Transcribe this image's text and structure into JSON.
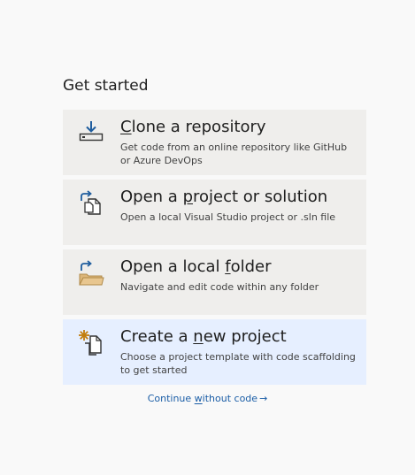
{
  "heading": "Get started",
  "cards": [
    {
      "id": "clone",
      "title_before": "",
      "title_hotkey": "C",
      "title_after": "lone a repository",
      "description": "Get code from an online repository like GitHub or Azure DevOps",
      "icon": "download-icon"
    },
    {
      "id": "open-project",
      "title_before": "Open a ",
      "title_hotkey": "p",
      "title_after": "roject or solution",
      "description": "Open a local Visual Studio project or .sln file",
      "icon": "open-project-icon"
    },
    {
      "id": "open-folder",
      "title_before": "Open a local ",
      "title_hotkey": "f",
      "title_after": "older",
      "description": "Navigate and edit code within any folder",
      "icon": "open-folder-icon"
    },
    {
      "id": "new-project",
      "title_before": "Create a ",
      "title_hotkey": "n",
      "title_after": "ew project",
      "description": "Choose a project template with code scaffolding to get started",
      "icon": "new-project-icon",
      "selected": true
    }
  ],
  "continue": {
    "before": "Continue ",
    "hotkey": "w",
    "after": "ithout code",
    "arrow": "→"
  },
  "colors": {
    "card_bg": "#efeeec",
    "card_selected_bg": "#e6efff",
    "link": "#1a5da6",
    "icon_blue": "#1f5d9e",
    "folder_orange": "#dcb67a",
    "star_orange": "#c27d0e"
  }
}
